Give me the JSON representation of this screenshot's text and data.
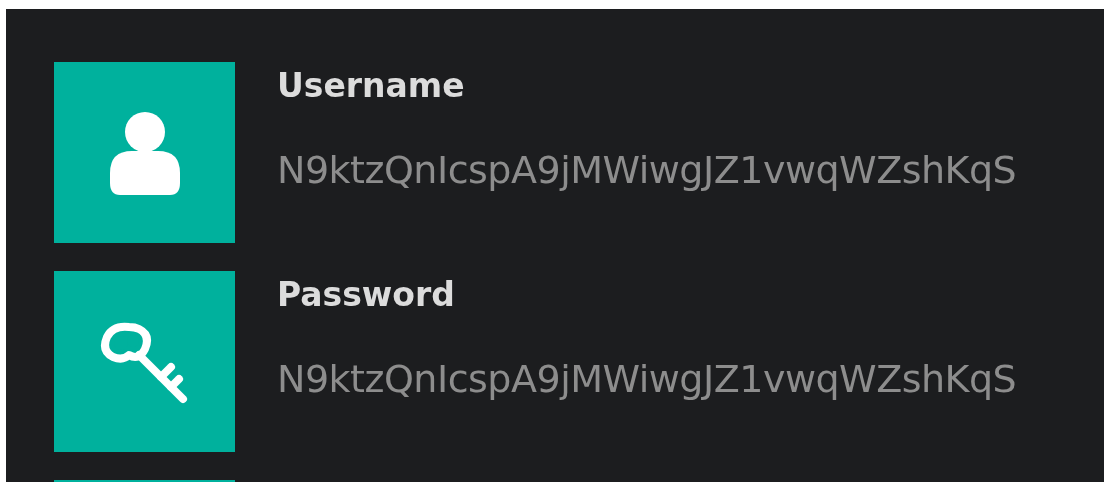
{
  "entries": [
    {
      "kind": "user",
      "label": "Username",
      "value": "N9ktzQnIcspA9jMWiwgJZ1vwqWZshKqS"
    },
    {
      "kind": "key",
      "label": "Password",
      "value": "N9ktzQnIcspA9jMWiwgJZ1vwqWZshKqS"
    }
  ]
}
